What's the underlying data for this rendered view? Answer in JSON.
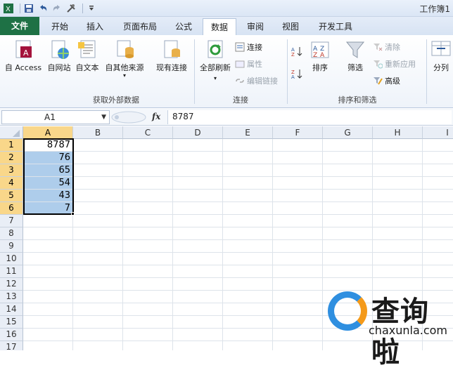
{
  "window": {
    "title": "工作簿1"
  },
  "tabs": [
    {
      "label": "文件"
    },
    {
      "label": "开始"
    },
    {
      "label": "插入"
    },
    {
      "label": "页面布局"
    },
    {
      "label": "公式"
    },
    {
      "label": "数据"
    },
    {
      "label": "审阅"
    },
    {
      "label": "视图"
    },
    {
      "label": "开发工具"
    }
  ],
  "ribbon": {
    "groups": {
      "external": "获取外部数据",
      "connections": "连接",
      "sortfilter": "排序和筛选"
    },
    "external_buttons": [
      "自 Access",
      "自网站",
      "自文本",
      "自其他来源",
      "现有连接"
    ],
    "refresh_all": "全部刷新",
    "connections_items": [
      "连接",
      "属性",
      "编辑链接"
    ],
    "sort": "排序",
    "filter": "筛选",
    "filter_items": [
      "清除",
      "重新应用",
      "高级"
    ],
    "split": "分列"
  },
  "formula_bar": {
    "name_box": "A1",
    "fx": "fx",
    "value": "8787"
  },
  "grid": {
    "columns": [
      "A",
      "B",
      "C",
      "D",
      "E",
      "F",
      "G",
      "H",
      "I"
    ],
    "rows": [
      "1",
      "2",
      "3",
      "4",
      "5",
      "6",
      "7",
      "8",
      "9",
      "10",
      "11",
      "12",
      "13",
      "14",
      "15",
      "16",
      "17"
    ],
    "values": [
      "8787",
      "76",
      "65",
      "54",
      "43",
      "7"
    ]
  },
  "watermark": {
    "brand": "查询啦",
    "url": "chaxunla.com"
  }
}
